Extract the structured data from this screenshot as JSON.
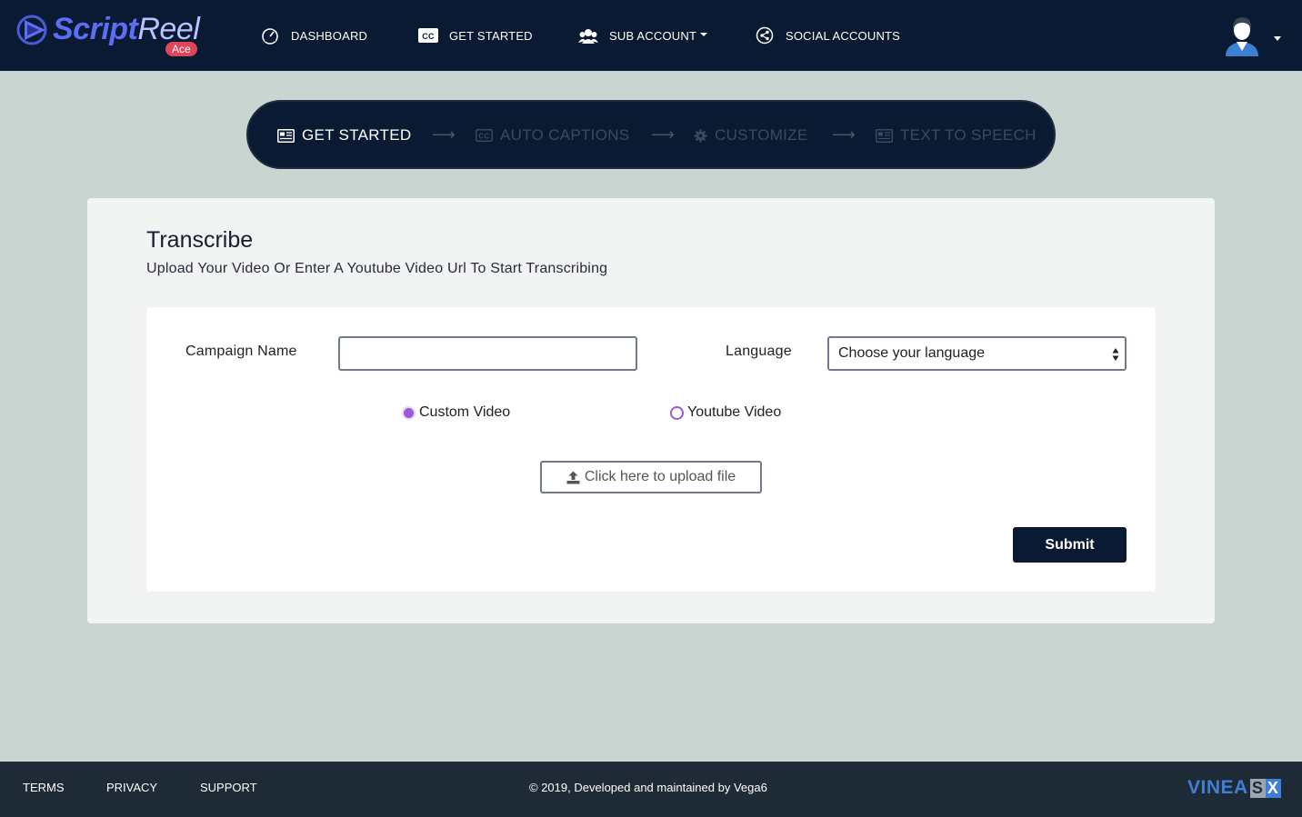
{
  "brand": {
    "part1": "Script",
    "part2": "Reel",
    "badge": "Ace"
  },
  "nav": {
    "dashboard": "DASHBOARD",
    "get_started": "GET STARTED",
    "sub_account": "SUB ACCOUNT",
    "social_accounts": "SOCIAL ACCOUNTS"
  },
  "stepper": {
    "steps": [
      {
        "label": "GET STARTED",
        "icon": "newspaper-icon",
        "active": true
      },
      {
        "label": "AUTO CAPTIONS",
        "icon": "cc-icon",
        "active": false
      },
      {
        "label": "CUSTOMIZE",
        "icon": "gear-icon",
        "active": false
      },
      {
        "label": "TEXT TO SPEECH",
        "icon": "newspaper-icon",
        "active": false
      }
    ],
    "arrow": "⟶"
  },
  "main": {
    "title": "Transcribe",
    "subtitle": "Upload Your Video Or Enter A Youtube Video Url To Start Transcribing",
    "form": {
      "campaign_label": "Campaign Name",
      "campaign_value": "",
      "language_label": "Language",
      "language_value": "Choose your language",
      "radio_custom": "Custom Video",
      "radio_youtube": "Youtube Video",
      "selected_source": "Custom Video",
      "upload_label": "Click here to upload file",
      "submit_label": "Submit"
    }
  },
  "footer": {
    "terms": "TERMS",
    "privacy": "PRIVACY",
    "support": "SUPPORT",
    "copyright": "© 2019, Developed and maintained by Vega6",
    "brand_text": "VINEA",
    "brand_s": "S",
    "brand_x": "X"
  },
  "colors": {
    "navy": "#0b1a33",
    "background": "#c8d5d1",
    "accent_purple": "#9b59d6",
    "badge_red": "#e0455a",
    "footer": "#1e2a36"
  }
}
